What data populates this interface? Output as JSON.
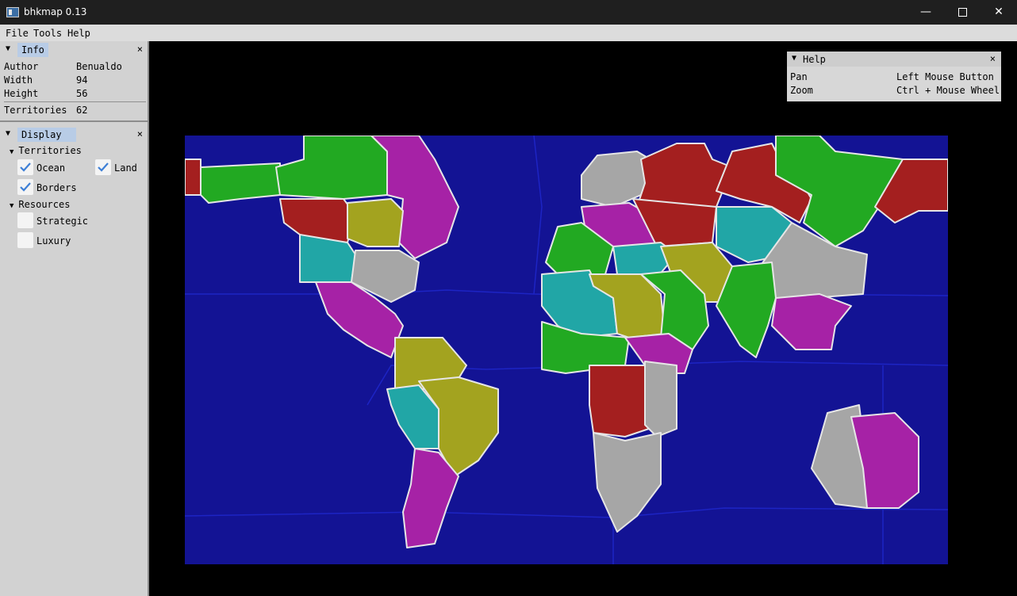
{
  "window": {
    "title": "bhkmap 0.13",
    "minimize": "—",
    "close": "✕"
  },
  "menu": [
    "File",
    "Tools",
    "Help"
  ],
  "info_panel": {
    "title": "Info",
    "close": "×",
    "rows": [
      {
        "key": "Author",
        "value": "Benualdo"
      },
      {
        "key": "Width",
        "value": "94"
      },
      {
        "key": "Height",
        "value": "56"
      }
    ],
    "territories_label": "Territories",
    "territories_value": "62"
  },
  "display_panel": {
    "title": "Display",
    "close": "×",
    "territories_group": "Territories",
    "ocean": {
      "label": "Ocean",
      "checked": true
    },
    "land": {
      "label": "Land",
      "checked": true
    },
    "borders": {
      "label": "Borders",
      "checked": true
    },
    "resources_group": "Resources",
    "strategic": {
      "label": "Strategic",
      "checked": false
    },
    "luxury": {
      "label": "Luxury",
      "checked": false
    }
  },
  "help_window": {
    "title": "Help",
    "close": "×",
    "rows": [
      {
        "action": "Pan",
        "binding": "Left Mouse Button"
      },
      {
        "action": "Zoom",
        "binding": "Ctrl + Mouse Wheel"
      }
    ]
  },
  "map": {
    "ocean_color": "#131394",
    "border_color": "#e6e6e6",
    "territory_colors": {
      "green": "#22a922",
      "magenta": "#a622a6",
      "olive": "#a3a31f",
      "teal": "#21a6a6",
      "gray": "#a6a6a6",
      "red": "#a41f1f"
    }
  },
  "icons": {
    "collapse": "collapse-triangle-icon",
    "checkmark": "checkmark-icon"
  }
}
